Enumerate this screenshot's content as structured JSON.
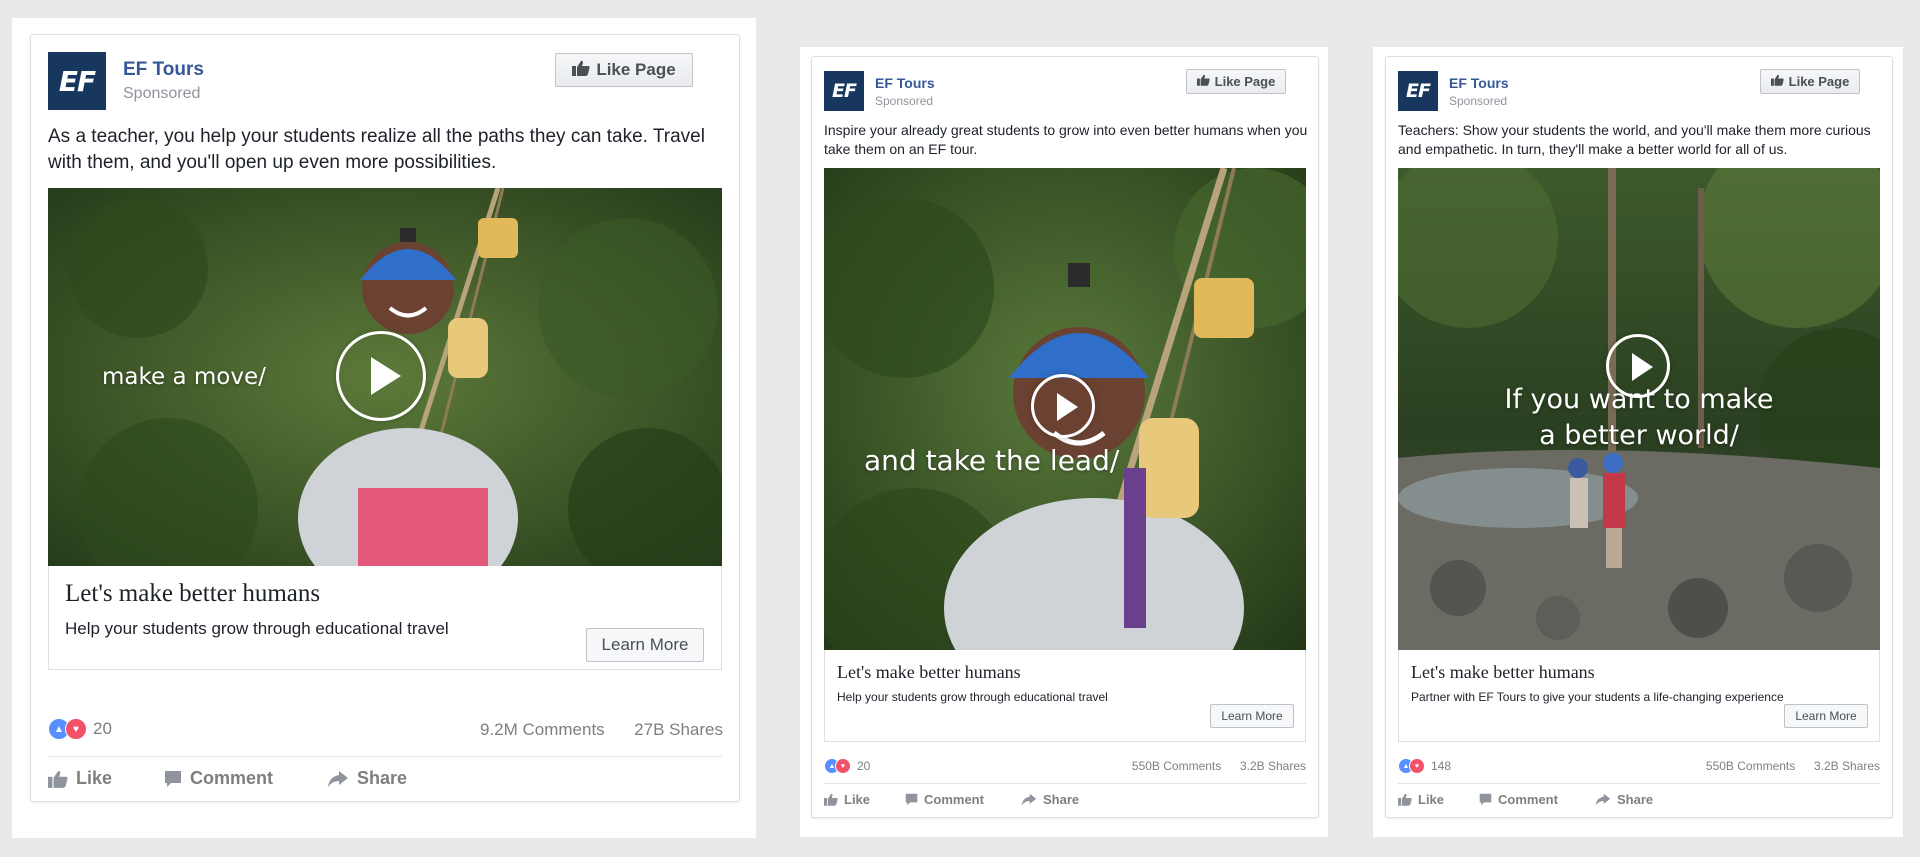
{
  "brand": {
    "page_name": "EF Tours",
    "sponsored": "Sponsored",
    "logo_text": "EF",
    "like_page": "Like Page",
    "logo_color": "#17375e",
    "link_color": "#365899"
  },
  "ads": [
    {
      "post_text": "As a teacher, you help your students realize all the paths they can take. Travel with them, and you'll open up even more possibilities.",
      "overlay": "make a move/",
      "headline": "Let's make better humans",
      "description": "Help your students grow through educational travel",
      "cta": "Learn More",
      "reaction_count": "20",
      "comments": "9.2M Comments",
      "shares": "27B Shares",
      "actions": {
        "like": "Like",
        "comment": "Comment",
        "share": "Share"
      }
    },
    {
      "post_text": "Inspire your already great students to grow into even better humans when you take them on an EF tour.",
      "overlay": "and take the lead/",
      "headline": "Let's make better humans",
      "description": "Help your students grow through educational travel",
      "cta": "Learn More",
      "reaction_count": "20",
      "comments": "550B Comments",
      "shares": "3.2B Shares",
      "actions": {
        "like": "Like",
        "comment": "Comment",
        "share": "Share"
      }
    },
    {
      "post_text": "Teachers: Show your students the world, and you'll make them more curious and empathetic. In turn, they'll make a better world for all of us.",
      "overlay_line1": "If you want to make",
      "overlay_line2": "a better world/",
      "headline": "Let's make better humans",
      "description": "Partner with EF Tours to give your students a life-changing experience",
      "cta": "Learn More",
      "reaction_count": "148",
      "comments": "550B Comments",
      "shares": "3.2B Shares",
      "actions": {
        "like": "Like",
        "comment": "Comment",
        "share": "Share"
      }
    }
  ]
}
